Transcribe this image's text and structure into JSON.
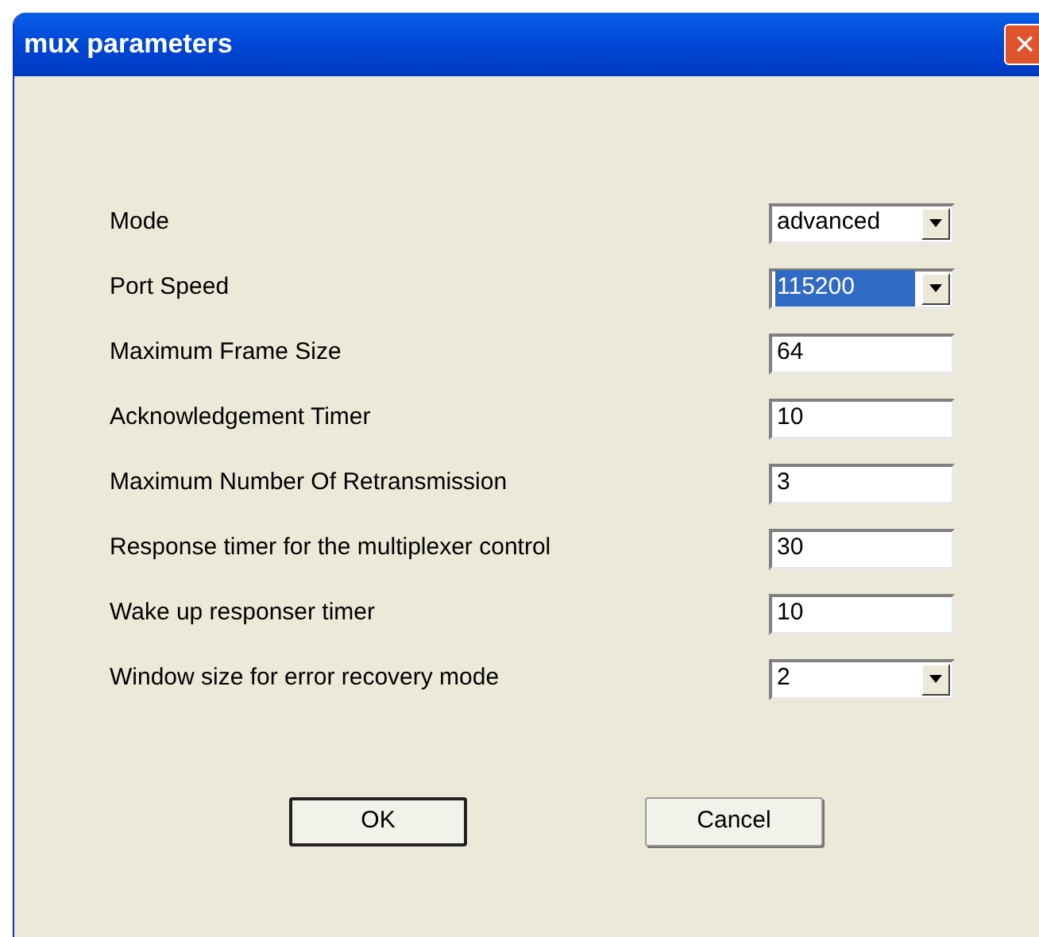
{
  "window": {
    "title": "mux parameters",
    "close_button": "×"
  },
  "fields": [
    {
      "label": "Mode",
      "kind": "select",
      "value": "advanced",
      "highlighted": false
    },
    {
      "label": "Port Speed",
      "kind": "select",
      "value": "115200",
      "highlighted": true
    },
    {
      "label": "Maximum Frame Size",
      "kind": "text",
      "value": "64",
      "highlighted": false
    },
    {
      "label": "Acknowledgement Timer",
      "kind": "text",
      "value": "10",
      "highlighted": false
    },
    {
      "label": "Maximum Number Of Retransmission",
      "kind": "text",
      "value": "3",
      "highlighted": false
    },
    {
      "label": "Response timer for the multiplexer control",
      "kind": "text",
      "value": "30",
      "highlighted": false
    },
    {
      "label": "Wake up responser timer",
      "kind": "text",
      "value": "10",
      "highlighted": false
    },
    {
      "label": "Window size for error recovery mode",
      "kind": "select",
      "value": "2",
      "highlighted": false
    }
  ],
  "buttons": [
    {
      "label": "OK",
      "default": true
    },
    {
      "label": "Cancel",
      "default": false
    }
  ]
}
